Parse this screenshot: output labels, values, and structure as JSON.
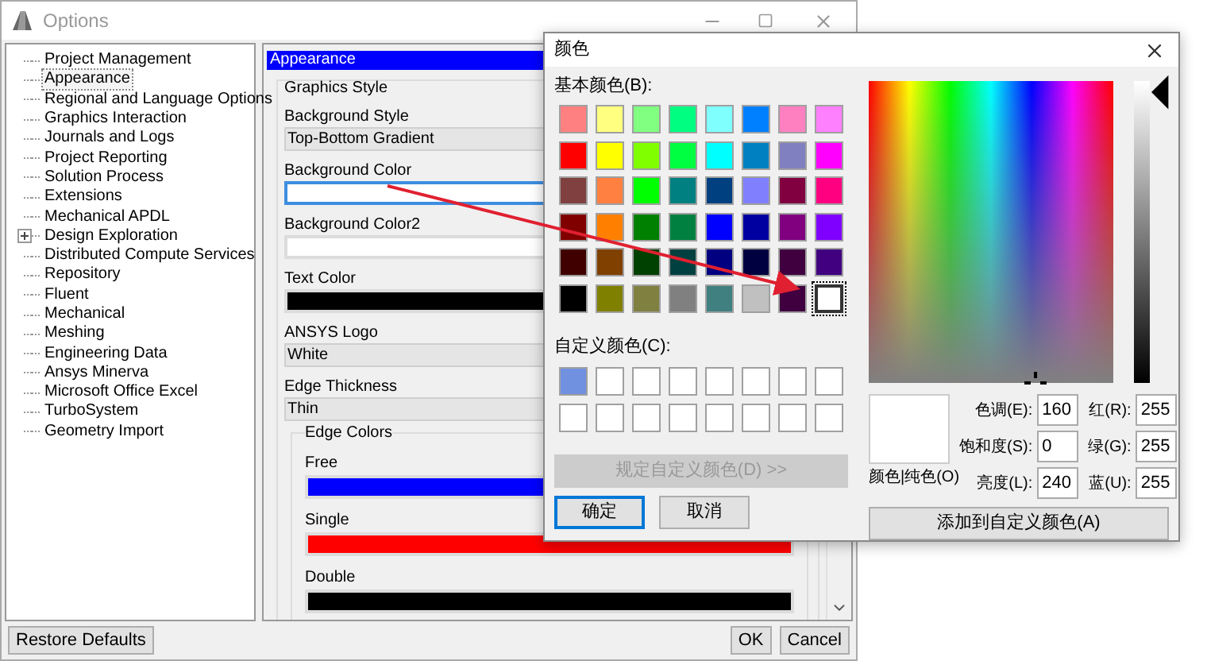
{
  "options_window": {
    "title": "Options",
    "tree": [
      {
        "label": "Project Management",
        "selected": false,
        "kind": "leaf"
      },
      {
        "label": "Appearance",
        "selected": true,
        "kind": "leaf"
      },
      {
        "label": "Regional and Language Options",
        "selected": false,
        "kind": "leaf"
      },
      {
        "label": "Graphics Interaction",
        "selected": false,
        "kind": "leaf"
      },
      {
        "label": "Journals and Logs",
        "selected": false,
        "kind": "leaf"
      },
      {
        "label": "Project Reporting",
        "selected": false,
        "kind": "leaf"
      },
      {
        "label": "Solution Process",
        "selected": false,
        "kind": "leaf"
      },
      {
        "label": "Extensions",
        "selected": false,
        "kind": "leaf"
      },
      {
        "label": "Mechanical APDL",
        "selected": false,
        "kind": "leaf"
      },
      {
        "label": "Design Exploration",
        "selected": false,
        "kind": "folder",
        "expanded": false
      },
      {
        "label": "Distributed Compute Services",
        "selected": false,
        "kind": "leaf"
      },
      {
        "label": "Repository",
        "selected": false,
        "kind": "leaf"
      },
      {
        "label": "Fluent",
        "selected": false,
        "kind": "leaf"
      },
      {
        "label": "Mechanical",
        "selected": false,
        "kind": "leaf"
      },
      {
        "label": "Meshing",
        "selected": false,
        "kind": "leaf"
      },
      {
        "label": "Engineering Data",
        "selected": false,
        "kind": "leaf"
      },
      {
        "label": "Ansys Minerva",
        "selected": false,
        "kind": "leaf"
      },
      {
        "label": "Microsoft Office Excel",
        "selected": false,
        "kind": "leaf"
      },
      {
        "label": "TurboSystem",
        "selected": false,
        "kind": "leaf"
      },
      {
        "label": "Geometry Import",
        "selected": false,
        "kind": "leaf"
      }
    ],
    "panel": {
      "header": "Appearance",
      "group": "Graphics Style",
      "fields": [
        {
          "label": "Background Style",
          "kind": "dropdown",
          "value": "Top-Bottom Gradient"
        },
        {
          "label": "Background Color",
          "kind": "color",
          "color": "#ffffff",
          "focused": true
        },
        {
          "label": "Background Color2",
          "kind": "color",
          "color": "#ffffff",
          "focused": false
        },
        {
          "label": "Text Color",
          "kind": "color",
          "color": "#000000",
          "focused": false
        },
        {
          "label": "ANSYS Logo",
          "kind": "dropdown",
          "value": "White"
        },
        {
          "label": "Edge Thickness",
          "kind": "dropdown",
          "value": "Thin"
        }
      ],
      "edge_colors": {
        "title": "Edge Colors",
        "items": [
          {
            "label": "Free",
            "color": "#0000ff"
          },
          {
            "label": "Single",
            "color": "#ff0000"
          },
          {
            "label": "Double",
            "color": "#000000"
          }
        ]
      }
    },
    "restore_button": "Restore Defaults",
    "ok_button": "OK",
    "cancel_button": "Cancel"
  },
  "color_dialog": {
    "title": "颜色",
    "basic_label": "基本颜色(B):",
    "basic_colors": [
      {
        "color": "#ff8080",
        "selected": false
      },
      {
        "color": "#ffff80",
        "selected": false
      },
      {
        "color": "#80ff80",
        "selected": false
      },
      {
        "color": "#00ff80",
        "selected": false
      },
      {
        "color": "#80ffff",
        "selected": false
      },
      {
        "color": "#0080ff",
        "selected": false
      },
      {
        "color": "#ff80c0",
        "selected": false
      },
      {
        "color": "#ff80ff",
        "selected": false
      },
      {
        "color": "#ff0000",
        "selected": false
      },
      {
        "color": "#ffff00",
        "selected": false
      },
      {
        "color": "#80ff00",
        "selected": false
      },
      {
        "color": "#00ff40",
        "selected": false
      },
      {
        "color": "#00ffff",
        "selected": false
      },
      {
        "color": "#0080c0",
        "selected": false
      },
      {
        "color": "#8080c0",
        "selected": false
      },
      {
        "color": "#ff00ff",
        "selected": false
      },
      {
        "color": "#804040",
        "selected": false
      },
      {
        "color": "#ff8040",
        "selected": false
      },
      {
        "color": "#00ff00",
        "selected": false
      },
      {
        "color": "#008080",
        "selected": false
      },
      {
        "color": "#004080",
        "selected": false
      },
      {
        "color": "#8080ff",
        "selected": false
      },
      {
        "color": "#800040",
        "selected": false
      },
      {
        "color": "#ff0080",
        "selected": false
      },
      {
        "color": "#800000",
        "selected": false
      },
      {
        "color": "#ff8000",
        "selected": false
      },
      {
        "color": "#008000",
        "selected": false
      },
      {
        "color": "#008040",
        "selected": false
      },
      {
        "color": "#0000ff",
        "selected": false
      },
      {
        "color": "#0000a0",
        "selected": false
      },
      {
        "color": "#800080",
        "selected": false
      },
      {
        "color": "#8000ff",
        "selected": false
      },
      {
        "color": "#400000",
        "selected": false
      },
      {
        "color": "#804000",
        "selected": false
      },
      {
        "color": "#004000",
        "selected": false
      },
      {
        "color": "#004040",
        "selected": false
      },
      {
        "color": "#000080",
        "selected": false
      },
      {
        "color": "#000040",
        "selected": false
      },
      {
        "color": "#400040",
        "selected": false
      },
      {
        "color": "#400080",
        "selected": false
      },
      {
        "color": "#000000",
        "selected": false
      },
      {
        "color": "#808000",
        "selected": false
      },
      {
        "color": "#808040",
        "selected": false
      },
      {
        "color": "#808080",
        "selected": false
      },
      {
        "color": "#408080",
        "selected": false
      },
      {
        "color": "#c0c0c0",
        "selected": false
      },
      {
        "color": "#400040",
        "selected": false
      },
      {
        "color": "#ffffff",
        "selected": true
      }
    ],
    "custom_label": "自定义颜色(C):",
    "custom_colors": [
      {
        "color": "#7090e0"
      },
      {
        "color": "#ffffff"
      },
      {
        "color": "#ffffff"
      },
      {
        "color": "#ffffff"
      },
      {
        "color": "#ffffff"
      },
      {
        "color": "#ffffff"
      },
      {
        "color": "#ffffff"
      },
      {
        "color": "#ffffff"
      },
      {
        "color": "#ffffff"
      },
      {
        "color": "#ffffff"
      },
      {
        "color": "#ffffff"
      },
      {
        "color": "#ffffff"
      },
      {
        "color": "#ffffff"
      },
      {
        "color": "#ffffff"
      },
      {
        "color": "#ffffff"
      },
      {
        "color": "#ffffff"
      }
    ],
    "define_button": {
      "label": "规定自定义颜色(D) >>",
      "disabled": true
    },
    "ok_button": "确定",
    "cancel_button": "取消",
    "preview_label": "颜色|纯色(O)",
    "values": [
      {
        "label": "色调(E):",
        "value": "160"
      },
      {
        "label": "红(R):",
        "value": "255"
      },
      {
        "label": "饱和度(S):",
        "value": "0"
      },
      {
        "label": "绿(G):",
        "value": "255"
      },
      {
        "label": "亮度(L):",
        "value": "240"
      },
      {
        "label": "蓝(U):",
        "value": "255"
      }
    ],
    "add_button": "添加到自定义颜色(A)"
  }
}
